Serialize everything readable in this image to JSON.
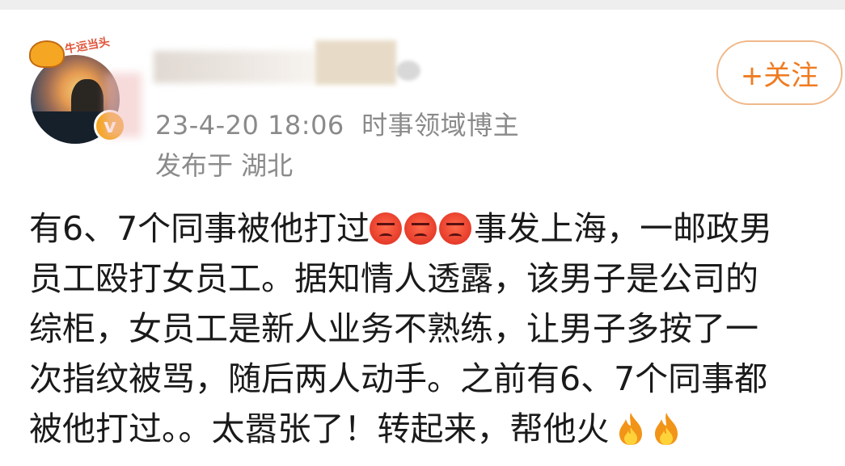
{
  "post": {
    "author": {
      "avatar_badge_text": "牛运当头",
      "verified_mark": "v"
    },
    "timestamp": "23-4-20 18:06",
    "author_title": "时事领域博主",
    "location": "发布于 湖北",
    "follow_label": "+关注",
    "body": {
      "line1_before": "有6、7个同事被他打过",
      "line1_after": "事发上海，一邮政男",
      "line2": "员工殴打女员工。据知情人透露，该男子是公司的",
      "line3": "综柜，女员工是新人业务不熟练，让男子多按了一",
      "line4": "次指纹被骂，随后两人动手。之前有6、7个同事都",
      "line5_before": "被他打过。。太嚣张了！转起来，帮他火"
    },
    "emojis": {
      "angry": "angry-face-icon",
      "fire": "fire-icon"
    }
  }
}
